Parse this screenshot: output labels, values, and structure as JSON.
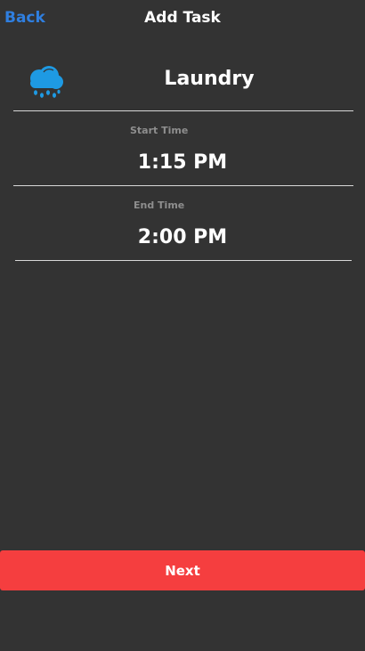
{
  "nav": {
    "back_label": "Back",
    "title": "Add Task"
  },
  "task": {
    "icon": "cloud-rain-icon",
    "icon_color": "#1e9ae3",
    "name": "Laundry"
  },
  "start": {
    "label": "Start Time",
    "value": "1:15 PM"
  },
  "end": {
    "label": "End Time",
    "value": "2:00 PM"
  },
  "footer": {
    "next_label": "Next",
    "button_color": "#f53e3f"
  },
  "colors": {
    "background": "#333333",
    "link": "#2f7fe0",
    "label": "#8e8e8e"
  }
}
